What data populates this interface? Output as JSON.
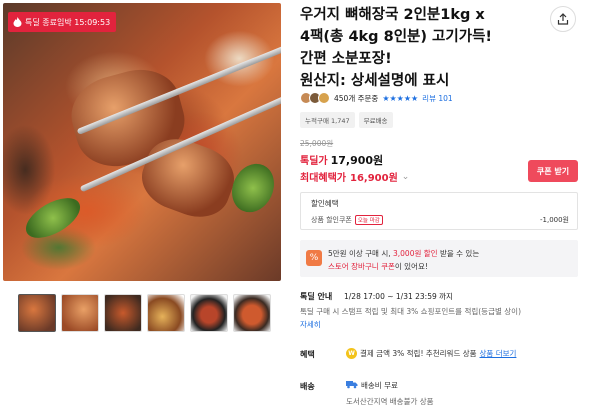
{
  "timer_badge": {
    "text": "특딜 종료임박 15:09:53"
  },
  "product": {
    "title_lines": [
      "우거지 뼈해장국 2인분1kg x",
      "4팩(총 4kg 8인분) 고기가득!",
      "간편 소분포장!",
      "원산지: 상세설명에 표시"
    ]
  },
  "rating": {
    "buyers": "450개 주문중",
    "stars": "★★★★★",
    "review": "리뷰 101"
  },
  "tags": [
    "누적구매 1,747",
    "무료배송"
  ],
  "price": {
    "original": "25,000원",
    "deal_label": "톡딜가",
    "deal_price": "17,900원",
    "max_label": "최대혜택가",
    "max_price": "16,900원"
  },
  "coupon_button": "쿠폰 받기",
  "discount": {
    "header": "할인혜택",
    "line_label": "상품 할인쿠폰",
    "line_tag": "오늘 마감",
    "amount": "-1,000원"
  },
  "promo": {
    "icon": "%",
    "l1_pre": "5만원 이상 구매 시, ",
    "l1_red": "3,000원 할인",
    "l1_post": " 받을 수 있는",
    "l2_red": "스토어 장바구니 쿠폰",
    "l2_post": "이 있어요!"
  },
  "deal_info": {
    "label": "톡딜 안내",
    "period": "1/28 17:00 ~ 1/31 23:59 까지",
    "desc": "톡딜 구매 시 스탬프 적립 및 최대 3% 쇼핑포인트를 적립(등급별 상이)",
    "link": "자세히"
  },
  "benefit": {
    "label": "혜택",
    "coin": "W",
    "text": "결제 금액 3% 적립! 추천리워드 상품",
    "link": "상품 더보기"
  },
  "shipping": {
    "label": "배송",
    "text": "배송비 무료",
    "note": "도서산간지역 배송불가 상품"
  },
  "colors": {
    "accent_red": "#e2233d",
    "link_blue": "#1d6fe0",
    "coupon_btn": "#ef4a5c"
  },
  "icons": {
    "timer": "flame-icon",
    "share": "share-icon",
    "chevron": "chevron-down-icon",
    "truck": "truck-icon"
  }
}
